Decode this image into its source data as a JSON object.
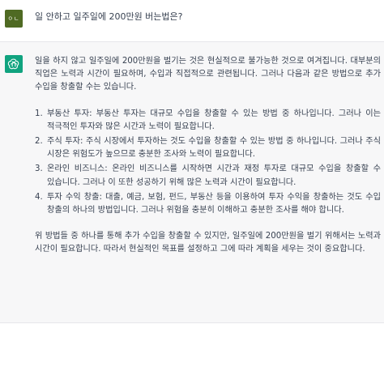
{
  "user": {
    "avatar_text": "ㅇㄴ",
    "message": "일 안하고 일주일에 200만원 버는법은?"
  },
  "assistant": {
    "avatar_icon": "openai-logo-icon",
    "intro": "일을 하지 않고 일주일에 200만원을 벌기는 것은 현실적으로 불가능한 것으로 여겨집니다. 대부분의 직업은 노력과 시간이 필요하며, 수입과 직접적으로 관련됩니다. 그러나 다음과 같은 방법으로 추가 수입을 창출할 수는 있습니다.",
    "items": [
      {
        "num": "1.",
        "text": "부동산 투자: 부동산 투자는 대규모 수입을 창출할 수 있는 방법 중 하나입니다. 그러나 이는 적극적인 투자와 많은 시간과 노력이 필요합니다."
      },
      {
        "num": "2.",
        "text": "주식 투자: 주식 시장에서 투자하는 것도 수입을 창출할 수 있는 방법 중 하나입니다. 그러나 주식 시장은 위험도가 높으므로 충분한 조사와 노력이 필요합니다."
      },
      {
        "num": "3.",
        "text": "온라인 비즈니스: 온라인 비즈니스를 시작하면 시간과 재정 투자로 대규모 수입을 창출할 수 있습니다. 그러나 이 또한 성공하기 위해 많은 노력과 시간이 필요합니다."
      },
      {
        "num": "4.",
        "text": "투자 수익 창출: 대출, 예금, 보험, 펀드, 부동산 등을 이용하여 투자 수익을 창출하는 것도 수입 창출의 하나의 방법입니다. 그러나 위험을 충분히 이해하고 충분한 조사를 해야 합니다."
      }
    ],
    "conclusion": "위 방법들 중 하나를 통해 추가 수입을 창출할 수 있지만, 일주일에 200만원을 벌기 위해서는 노력과 시간이 필요합니다. 따라서 현실적인 목표를 설정하고 그에 따라 계획을 세우는 것이 중요합니다."
  },
  "colors": {
    "user_avatar": "#4f6a23",
    "assistant_avatar": "#10a37f",
    "assistant_bg": "#f7f7f8",
    "text": "#374151"
  }
}
